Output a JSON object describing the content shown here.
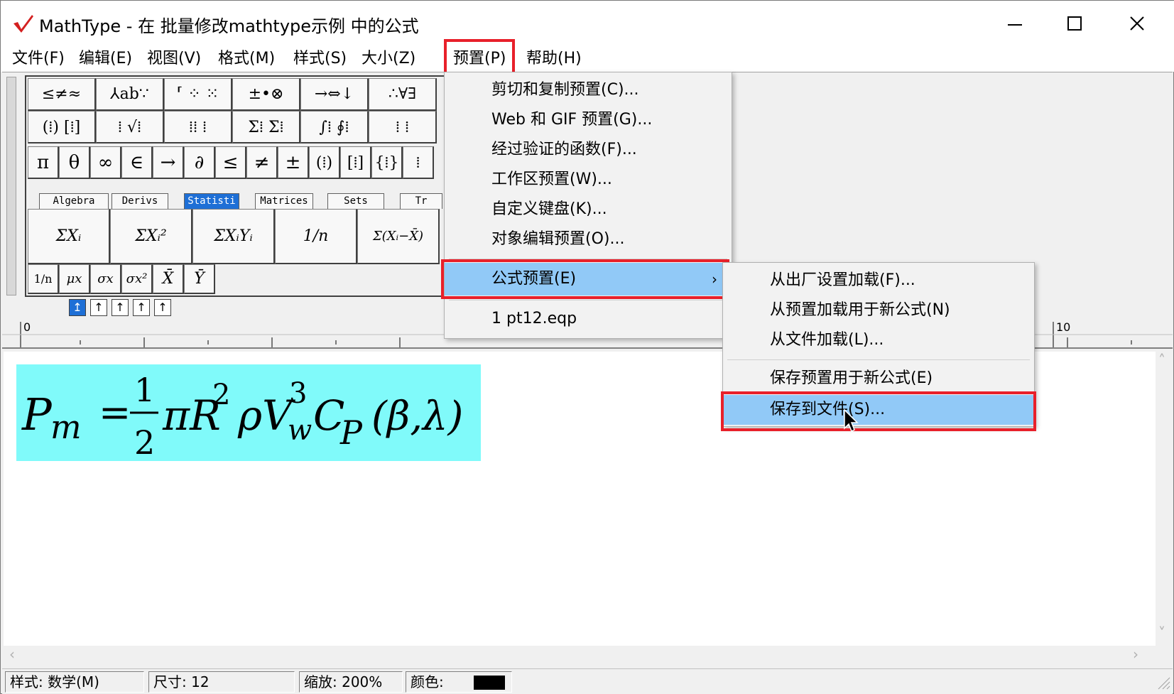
{
  "window": {
    "title": "MathType - 在 批量修改mathtype示例 中的公式",
    "controls": {
      "minimize": "—",
      "maximize": "☐",
      "close": "✕"
    },
    "logo_icon": "mathtype-logo-icon"
  },
  "menubar": {
    "items": [
      {
        "label": "文件(F)"
      },
      {
        "label": "编辑(E)"
      },
      {
        "label": "视图(V)"
      },
      {
        "label": "格式(M)"
      },
      {
        "label": "样式(S)"
      },
      {
        "label": "大小(Z)"
      },
      {
        "label": "预置(P)",
        "active": true
      },
      {
        "label": "帮助(H)"
      }
    ]
  },
  "palette": {
    "row1": [
      "≤≠≈",
      "⅄ab∵",
      "⸢ ⁘ ⁙",
      "±•⊗",
      "→⇔↓",
      "∴∀∃"
    ],
    "row2": [
      "(⁞) [⁞]",
      "⁞ √⁞",
      "⁞⁞ ⁞",
      "Σ⁞ Σ⁞",
      "∫⁞ ∮⁞",
      "⁞ ⁞"
    ],
    "row3": [
      "π",
      "θ",
      "∞",
      "∈",
      "→",
      "∂",
      "≤",
      "≠",
      "±",
      "(⁞)",
      "[⁞]",
      "{⁞}",
      "⁞"
    ],
    "tabs": [
      "Algebra",
      "Derivs",
      "Statisti",
      "Matrices",
      "Sets",
      "Tr"
    ],
    "selected_tab": "Statisti",
    "stat_row1": [
      "ΣXᵢ",
      "ΣXᵢ²",
      "ΣXᵢYᵢ",
      "1/n",
      "Σ(Xᵢ−X̄)"
    ],
    "stat_row2": [
      "1/n",
      "μx",
      "σx",
      "σx²",
      "X̄",
      "Ȳ"
    ]
  },
  "ruler": {
    "start_label": "0",
    "end_label": "10"
  },
  "preset_menu": {
    "items": [
      {
        "label": "剪切和复制预置(C)..."
      },
      {
        "label": "Web 和 GIF 预置(G)..."
      },
      {
        "label": "经过验证的函数(F)..."
      },
      {
        "label": "工作区预置(W)..."
      },
      {
        "label": "自定义键盘(K)..."
      },
      {
        "label": "对象编辑预置(O)..."
      },
      {
        "label": "公式预置(E)",
        "submenu": true,
        "highlighted": true
      },
      {
        "label": "1 pt12.eqp"
      }
    ],
    "submenu_arrow": "›"
  },
  "equation_presets_submenu": {
    "items": [
      {
        "label": "从出厂设置加载(F)..."
      },
      {
        "label": "从预置加载用于新公式(N)"
      },
      {
        "label": "从文件加载(L)..."
      },
      {
        "label": "保存预置用于新公式(E)"
      },
      {
        "label": "保存到文件(S)...",
        "highlighted": true
      }
    ]
  },
  "formula": {
    "lhs": "P",
    "lhs_sub": "m",
    "equals": "=",
    "frac_num": "1",
    "frac_den": "2",
    "body1": "πR",
    "sup1": "2",
    "body2": "ρV",
    "sup2": "3",
    "sub2": "w",
    "body3": "C",
    "sub3": "P",
    "args": "(β,λ)",
    "highlight_color": "#80fafa"
  },
  "statusbar": {
    "style": "样式: 数学(M)",
    "size": "尺寸: 12",
    "zoom": "缩放: 200%",
    "color": "颜色:"
  },
  "colors": {
    "highlight_border": "#e8202a",
    "menu_highlight": "#91c9f7",
    "selected_tab": "#1e6fd6"
  }
}
